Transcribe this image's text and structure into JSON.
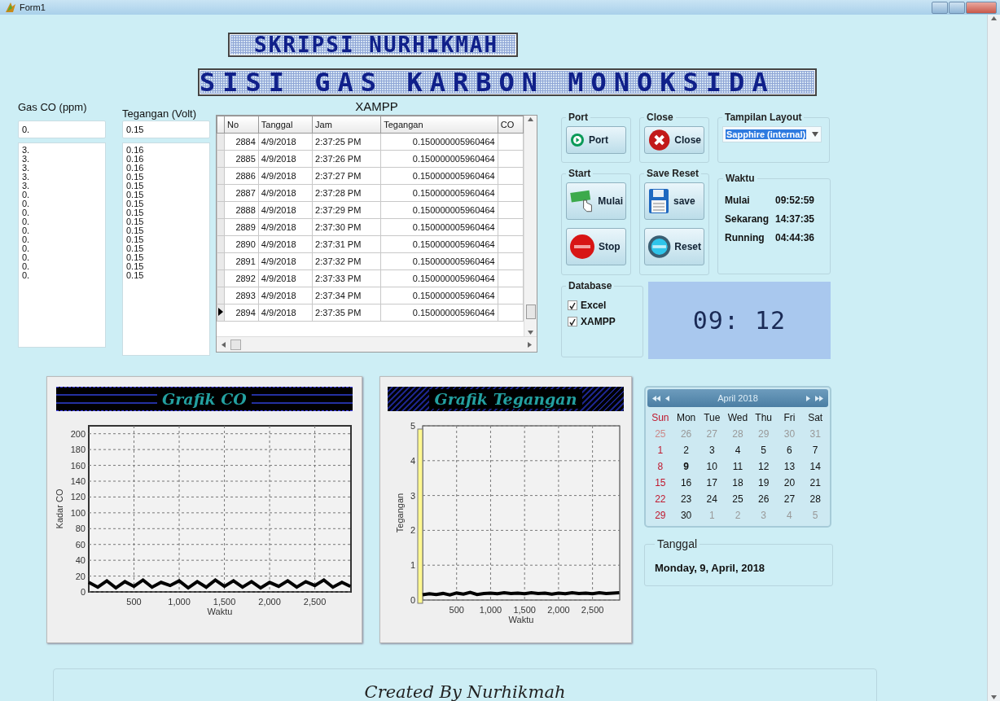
{
  "window": {
    "title": "Form1"
  },
  "banners": [
    "SKRIPSI NURHIKMAH",
    "SISI GAS KARBON MONOKSIDA"
  ],
  "gas_co": {
    "label": "Gas CO (ppm)",
    "value": "0.",
    "history": [
      "3.",
      "3.",
      "3.",
      "3.",
      "3.",
      "0.",
      "0.",
      "0.",
      "0.",
      "0.",
      "0.",
      "0.",
      "0.",
      "0.",
      "0."
    ]
  },
  "tegangan": {
    "label": "Tegangan (Volt)",
    "value": "0.15",
    "history": [
      "0.16",
      "0.16",
      "0.16",
      "0.15",
      "0.15",
      "0.15",
      "0.15",
      "0.15",
      "0.15",
      "0.15",
      "0.15",
      "0.15",
      "0.15",
      "0.15",
      "0.15"
    ]
  },
  "table": {
    "title": "XAMPP",
    "columns": [
      "No",
      "Tanggal",
      "Jam",
      "Tegangan",
      "CO"
    ],
    "rows": [
      {
        "cells": [
          "2884",
          "4/9/2018",
          "2:37:25 PM",
          "0.150000005960464"
        ],
        "current": false
      },
      {
        "cells": [
          "2885",
          "4/9/2018",
          "2:37:26 PM",
          "0.150000005960464"
        ],
        "current": false
      },
      {
        "cells": [
          "2886",
          "4/9/2018",
          "2:37:27 PM",
          "0.150000005960464"
        ],
        "current": false
      },
      {
        "cells": [
          "2887",
          "4/9/2018",
          "2:37:28 PM",
          "0.150000005960464"
        ],
        "current": false
      },
      {
        "cells": [
          "2888",
          "4/9/2018",
          "2:37:29 PM",
          "0.150000005960464"
        ],
        "current": false
      },
      {
        "cells": [
          "2889",
          "4/9/2018",
          "2:37:30 PM",
          "0.150000005960464"
        ],
        "current": false
      },
      {
        "cells": [
          "2890",
          "4/9/2018",
          "2:37:31 PM",
          "0.150000005960464"
        ],
        "current": false
      },
      {
        "cells": [
          "2891",
          "4/9/2018",
          "2:37:32 PM",
          "0.150000005960464"
        ],
        "current": false
      },
      {
        "cells": [
          "2892",
          "4/9/2018",
          "2:37:33 PM",
          "0.150000005960464"
        ],
        "current": false
      },
      {
        "cells": [
          "2893",
          "4/9/2018",
          "2:37:34 PM",
          "0.150000005960464"
        ],
        "current": false
      },
      {
        "cells": [
          "2894",
          "4/9/2018",
          "2:37:35 PM",
          "0.150000005960464"
        ],
        "current": true
      }
    ]
  },
  "port": {
    "title": "Port",
    "buttons": [
      {
        "label": "Port",
        "kind": "play"
      }
    ]
  },
  "close": {
    "title": "Close",
    "buttons": [
      {
        "label": "Close",
        "kind": "cancel"
      }
    ]
  },
  "layout": {
    "title": "Tampilan Layout",
    "value": "Sapphire (internal)"
  },
  "start": {
    "title": "Start",
    "buttons": [
      {
        "label": "Mulai",
        "kind": "start"
      },
      {
        "label": "Stop",
        "kind": "stop"
      }
    ]
  },
  "save_reset": {
    "title": "Save Reset",
    "buttons": [
      {
        "label": "save",
        "kind": "save"
      },
      {
        "label": "Reset",
        "kind": "reset"
      }
    ]
  },
  "waktu": {
    "title": "Waktu",
    "rows": [
      {
        "label": "Mulai",
        "value": "09:52:59"
      },
      {
        "label": "Sekarang",
        "value": "14:37:35"
      },
      {
        "label": "Running",
        "value": "04:44:36"
      }
    ]
  },
  "database": {
    "title": "Database",
    "options": [
      {
        "label": "Excel",
        "checked": true
      },
      {
        "label": "XAMPP",
        "checked": true
      }
    ]
  },
  "clock": {
    "display": "09: 12"
  },
  "charts": [
    {
      "chart_data": {
        "type": "line",
        "title": "Grafik CO",
        "xlabel": "Waktu",
        "ylabel": "Kadar CO",
        "xlim": [
          0,
          2900
        ],
        "ylim": [
          0,
          210
        ],
        "xticks": [
          500,
          {
            "value": 1000,
            "label": "1,000"
          },
          {
            "value": 1500,
            "label": "1,500"
          },
          {
            "value": 2000,
            "label": "2,000"
          },
          {
            "value": 2500,
            "label": "2,500"
          }
        ],
        "yticks": [
          0,
          20,
          40,
          60,
          80,
          100,
          120,
          140,
          160,
          180,
          200
        ],
        "x": [
          0,
          100,
          200,
          300,
          400,
          500,
          600,
          700,
          800,
          900,
          1000,
          1100,
          1200,
          1300,
          1400,
          1500,
          1600,
          1700,
          1800,
          1900,
          2000,
          2100,
          2200,
          2300,
          2400,
          2500,
          2600,
          2700,
          2800,
          2894
        ],
        "grid": true,
        "series": [
          {
            "color": "#000000",
            "values": [
              12,
              6,
              14,
              5,
              13,
              7,
              15,
              6,
              12,
              8,
              14,
              5,
              13,
              6,
              15,
              7,
              14,
              6,
              13,
              5,
              12,
              7,
              14,
              6,
              13,
              8,
              15,
              6,
              12,
              7
            ]
          }
        ]
      }
    },
    {
      "chart_data": {
        "type": "line",
        "title": "Grafik Tegangan",
        "xlabel": "Waktu",
        "ylabel": "Tegangan",
        "xlim": [
          0,
          2900
        ],
        "ylim": [
          0,
          5
        ],
        "xticks": [
          500,
          {
            "value": 1000,
            "label": "1,000"
          },
          {
            "value": 1500,
            "label": "1,500"
          },
          {
            "value": 2000,
            "label": "2,000"
          },
          {
            "value": 2500,
            "label": "2,500"
          }
        ],
        "yticks": [
          0,
          1,
          2,
          3,
          4,
          5
        ],
        "x": [
          0,
          100,
          200,
          300,
          400,
          500,
          600,
          700,
          800,
          900,
          1000,
          1100,
          1200,
          1300,
          1400,
          1500,
          1600,
          1700,
          1800,
          1900,
          2000,
          2100,
          2200,
          2300,
          2400,
          2500,
          2600,
          2700,
          2800,
          2894
        ],
        "grid": true,
        "series": [
          {
            "color": "#000000",
            "values": [
              0.15,
              0.18,
              0.16,
              0.19,
              0.15,
              0.2,
              0.17,
              0.22,
              0.16,
              0.19,
              0.2,
              0.18,
              0.21,
              0.19,
              0.2,
              0.18,
              0.21,
              0.19,
              0.2,
              0.17,
              0.2,
              0.18,
              0.21,
              0.19,
              0.2,
              0.18,
              0.21,
              0.19,
              0.2,
              0.21
            ]
          }
        ]
      }
    }
  ],
  "calendar": {
    "month": "April 2018",
    "weekdays": [
      "Sun",
      "Mon",
      "Tue",
      "Wed",
      "Thu",
      "Fri",
      "Sat"
    ],
    "weeks": [
      [
        {
          "d": "25",
          "other": true,
          "selected": false
        },
        {
          "d": "26",
          "other": true,
          "selected": false
        },
        {
          "d": "27",
          "other": true,
          "selected": false
        },
        {
          "d": "28",
          "other": true,
          "selected": false
        },
        {
          "d": "29",
          "other": true,
          "selected": false
        },
        {
          "d": "30",
          "other": true,
          "selected": false
        },
        {
          "d": "31",
          "other": true,
          "selected": false
        }
      ],
      [
        {
          "d": "1",
          "other": false,
          "selected": false
        },
        {
          "d": "2",
          "other": false,
          "selected": false
        },
        {
          "d": "3",
          "other": false,
          "selected": false
        },
        {
          "d": "4",
          "other": false,
          "selected": false
        },
        {
          "d": "5",
          "other": false,
          "selected": false
        },
        {
          "d": "6",
          "other": false,
          "selected": false
        },
        {
          "d": "7",
          "other": false,
          "selected": false
        }
      ],
      [
        {
          "d": "8",
          "other": false,
          "selected": false
        },
        {
          "d": "9",
          "other": false,
          "selected": true
        },
        {
          "d": "10",
          "other": false,
          "selected": false
        },
        {
          "d": "11",
          "other": false,
          "selected": false
        },
        {
          "d": "12",
          "other": false,
          "selected": false
        },
        {
          "d": "13",
          "other": false,
          "selected": false
        },
        {
          "d": "14",
          "other": false,
          "selected": false
        }
      ],
      [
        {
          "d": "15",
          "other": false,
          "selected": false
        },
        {
          "d": "16",
          "other": false,
          "selected": false
        },
        {
          "d": "17",
          "other": false,
          "selected": false
        },
        {
          "d": "18",
          "other": false,
          "selected": false
        },
        {
          "d": "19",
          "other": false,
          "selected": false
        },
        {
          "d": "20",
          "other": false,
          "selected": false
        },
        {
          "d": "21",
          "other": false,
          "selected": false
        }
      ],
      [
        {
          "d": "22",
          "other": false,
          "selected": false
        },
        {
          "d": "23",
          "other": false,
          "selected": false
        },
        {
          "d": "24",
          "other": false,
          "selected": false
        },
        {
          "d": "25",
          "other": false,
          "selected": false
        },
        {
          "d": "26",
          "other": false,
          "selected": false
        },
        {
          "d": "27",
          "other": false,
          "selected": false
        },
        {
          "d": "28",
          "other": false,
          "selected": false
        }
      ],
      [
        {
          "d": "29",
          "other": false,
          "selected": false
        },
        {
          "d": "30",
          "other": false,
          "selected": false
        },
        {
          "d": "1",
          "other": true,
          "selected": false
        },
        {
          "d": "2",
          "other": true,
          "selected": false
        },
        {
          "d": "3",
          "other": true,
          "selected": false
        },
        {
          "d": "4",
          "other": true,
          "selected": false
        },
        {
          "d": "5",
          "other": true,
          "selected": false
        }
      ]
    ]
  },
  "tanggal": {
    "title": "Tanggal",
    "value": "Monday, 9, April, 2018"
  },
  "footer": {
    "text": "Created By Nurhikmah"
  }
}
